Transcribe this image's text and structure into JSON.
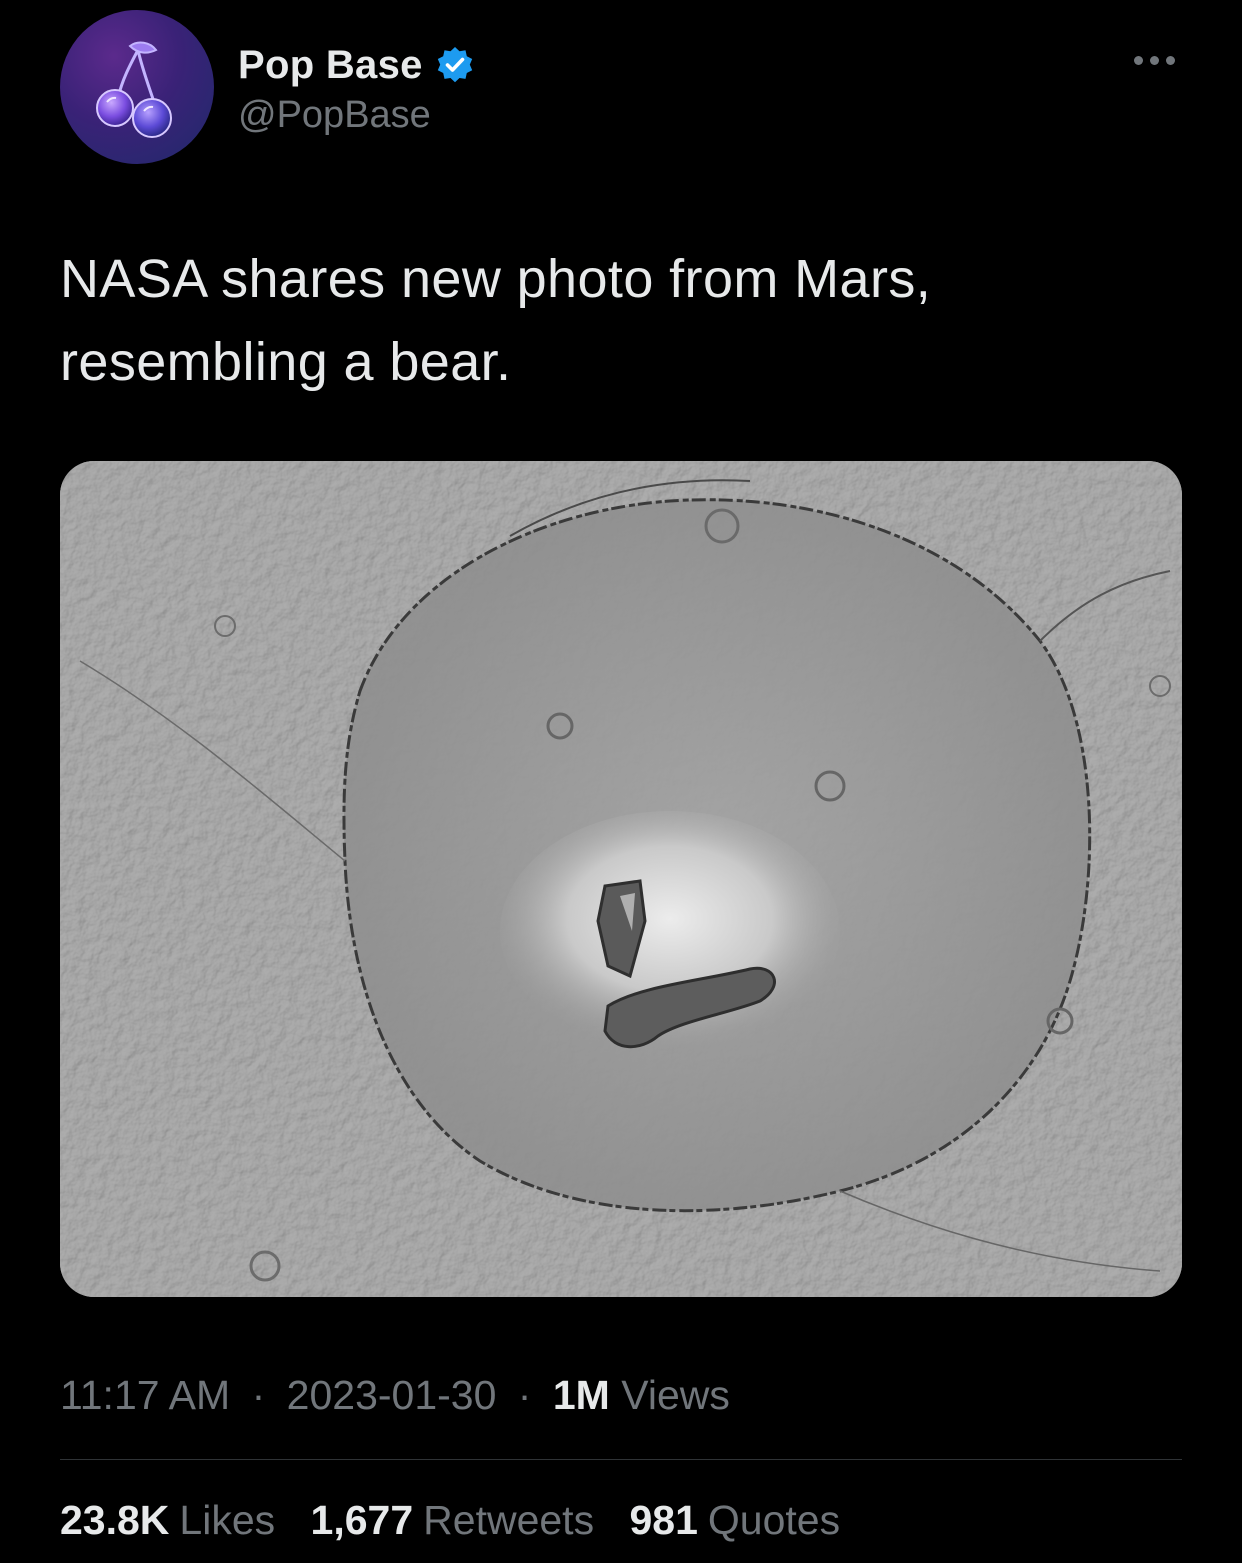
{
  "author": {
    "display_name": "Pop Base",
    "handle": "@PopBase",
    "verified": true,
    "verified_color": "#1d9bf0",
    "avatar_icon": "cherries-icon"
  },
  "tweet": {
    "text_line1": "NASA shares new photo from Mars,",
    "text_line2": "resembling a bear.",
    "media_alt": ""
  },
  "meta": {
    "time": "11:17 AM",
    "date": "2023-01-30",
    "views_count": "1M",
    "views_label": "Views",
    "separator": "·"
  },
  "stats": {
    "likes_count": "23.8K",
    "likes_label": "Likes",
    "retweets_count": "1,677",
    "retweets_label": "Retweets",
    "quotes_count": "981",
    "quotes_label": "Quotes"
  },
  "colors": {
    "background": "#000000",
    "text_primary": "#e7e9ea",
    "text_secondary": "#71767b",
    "divider": "#2f3336"
  }
}
